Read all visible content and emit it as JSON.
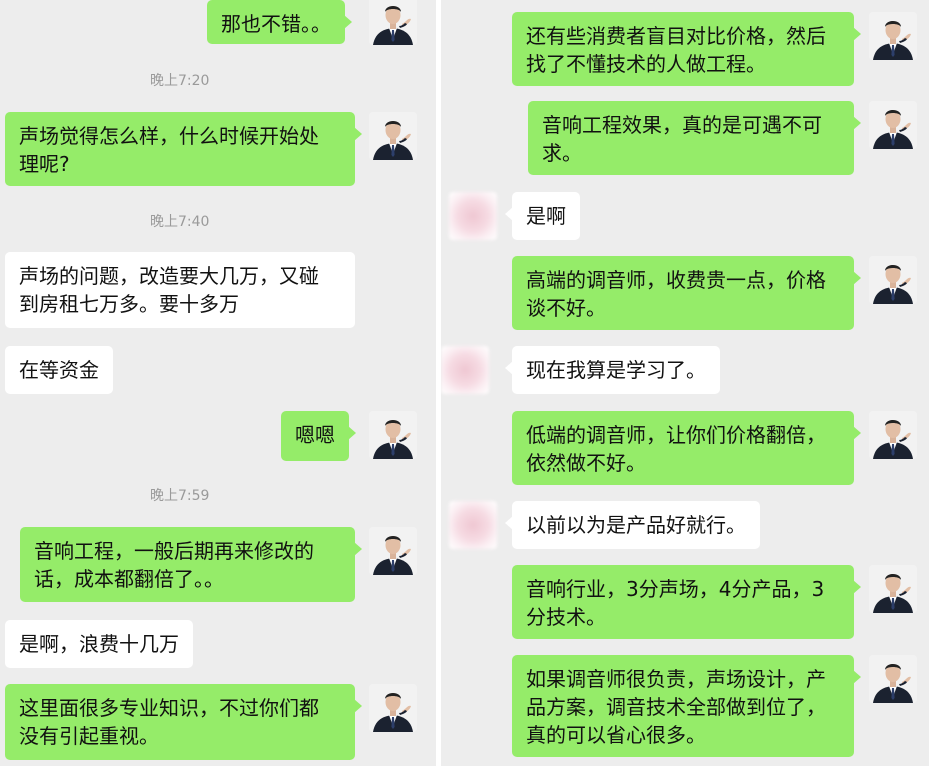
{
  "colors": {
    "chat_bg": "#ededed",
    "my_bubble": "#95ec69",
    "their_bubble": "#ffffff",
    "timestamp": "#9a9a9a"
  },
  "left": {
    "timestamps": [
      "晚上7:20",
      "晚上7:40",
      "晚上7:59"
    ],
    "messages": [
      {
        "side": "me",
        "lines": [
          "那也不错。。"
        ]
      },
      {
        "side": "me",
        "lines": [
          "声场觉得怎么样，什么时候开始处",
          "理呢?"
        ]
      },
      {
        "side": "other",
        "lines": [
          "声场的问题，改造要大几万，又碰",
          "到房租七万多。要十多万"
        ]
      },
      {
        "side": "other",
        "lines": [
          "在等资金"
        ]
      },
      {
        "side": "me",
        "lines": [
          "嗯嗯"
        ]
      },
      {
        "side": "me",
        "lines": [
          "音响工程，一般后期再来修改的",
          "话，成本都翻倍了。。"
        ]
      },
      {
        "side": "other",
        "lines": [
          "是啊，浪费十几万"
        ]
      },
      {
        "side": "me",
        "lines": [
          "这里面很多专业知识，不过你们都",
          "没有引起重视。"
        ]
      }
    ]
  },
  "right": {
    "messages": [
      {
        "side": "me",
        "lines": [
          "还有些消费者盲目对比价格，然后",
          "找了不懂技术的人做工程。"
        ]
      },
      {
        "side": "me",
        "lines": [
          "音响工程效果，真的是可遇不可",
          "求。"
        ]
      },
      {
        "side": "other",
        "lines": [
          "是啊"
        ]
      },
      {
        "side": "me",
        "lines": [
          "高端的调音师，收费贵一点，价格",
          "谈不好。"
        ]
      },
      {
        "side": "other",
        "lines": [
          "现在我算是学习了。"
        ]
      },
      {
        "side": "me",
        "lines": [
          "低端的调音师，让你们价格翻倍，",
          "依然做不好。"
        ]
      },
      {
        "side": "other",
        "lines": [
          "以前以为是产品好就行。"
        ]
      },
      {
        "side": "me",
        "lines": [
          "音响行业，3分声场，4分产品，3",
          "分技术。"
        ]
      },
      {
        "side": "me",
        "lines": [
          "如果调音师很负责，声场设计，产",
          "品方案，调音技术全部做到位了，",
          "真的可以省心很多。"
        ]
      }
    ]
  }
}
